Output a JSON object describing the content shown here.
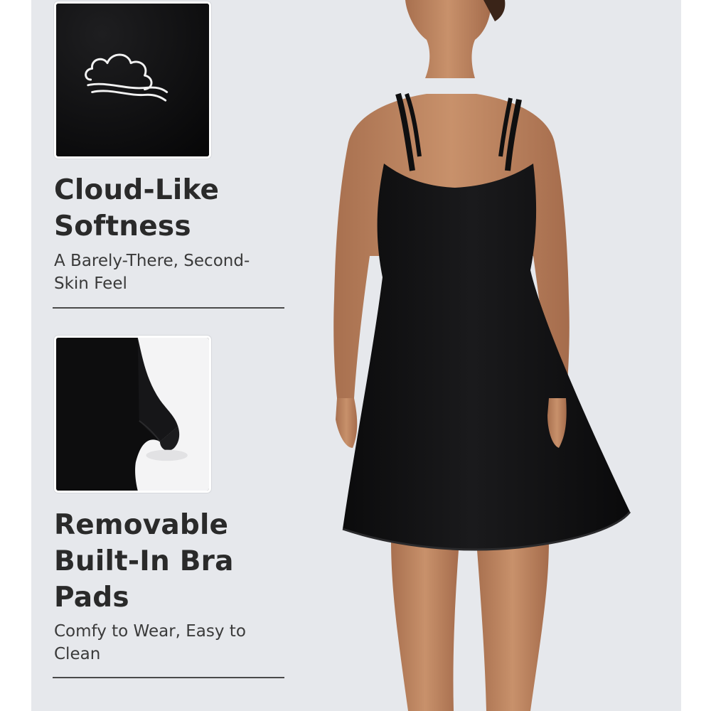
{
  "features": [
    {
      "icon": "cloud-icon",
      "title_line1": "Cloud-Like",
      "title_line2": "Softness",
      "subtitle_line1": "A Barely-There, Second-",
      "subtitle_line2": "Skin Feel"
    },
    {
      "icon": "bra-pad-fabric-image",
      "title_line1": "Removable",
      "title_line2": "Built-In Bra",
      "title_line3": "Pads",
      "subtitle_line1": "Comfy to Wear, Easy to",
      "subtitle_line2": "Clean"
    }
  ],
  "colors": {
    "panel_background": "#e6e8ec",
    "heading_text": "#2a2a2a",
    "garment": "#111111",
    "skin": "#c48a66"
  }
}
